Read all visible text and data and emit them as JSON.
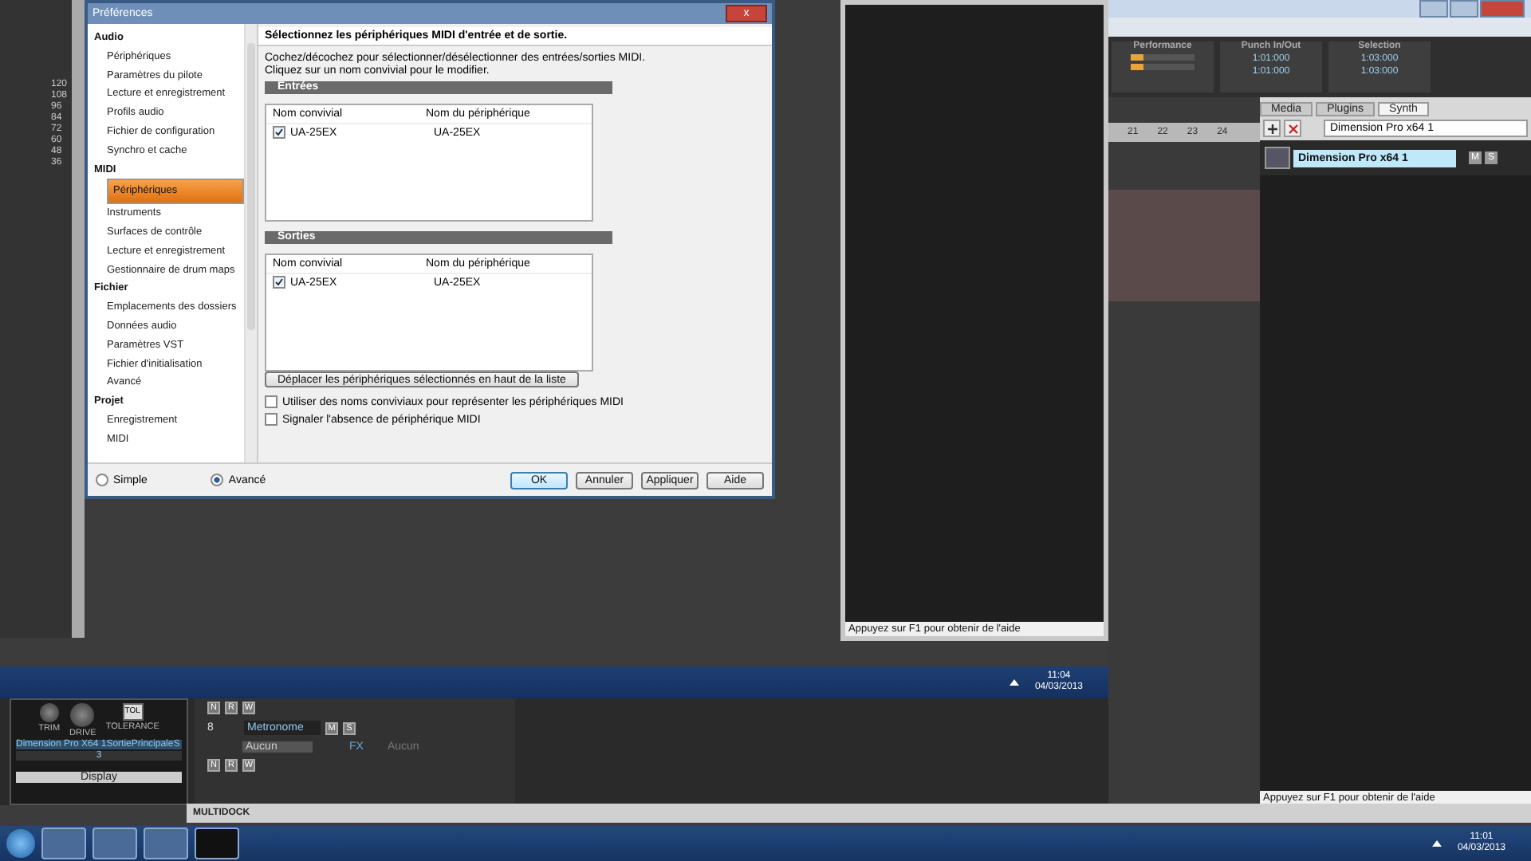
{
  "preferences": {
    "title": "Préférences",
    "close": "x",
    "tree": [
      {
        "label": "Audio",
        "children": [
          {
            "label": "Périphériques",
            "selected": false
          },
          {
            "label": "Paramètres du pilote",
            "selected": false
          },
          {
            "label": "Lecture et enregistrement",
            "selected": false
          },
          {
            "label": "Profils audio",
            "selected": false
          },
          {
            "label": "Fichier de configuration",
            "selected": false
          },
          {
            "label": "Synchro et cache",
            "selected": false
          }
        ]
      },
      {
        "label": "MIDI",
        "children": [
          {
            "label": "Périphériques",
            "selected": true
          },
          {
            "label": "Instruments",
            "selected": false
          },
          {
            "label": "Surfaces de contrôle",
            "selected": false
          },
          {
            "label": "Lecture et enregistrement",
            "selected": false
          },
          {
            "label": "Gestionnaire de drum maps",
            "selected": false
          }
        ]
      },
      {
        "label": "Fichier",
        "children": [
          {
            "label": "Emplacements des dossiers",
            "selected": false
          },
          {
            "label": "Données audio",
            "selected": false
          },
          {
            "label": "Paramètres VST",
            "selected": false
          },
          {
            "label": "Fichier d'initialisation",
            "selected": false
          },
          {
            "label": "Avancé",
            "selected": false
          }
        ]
      },
      {
        "label": "Projet",
        "children": [
          {
            "label": "Enregistrement",
            "selected": false
          },
          {
            "label": "MIDI",
            "selected": false
          }
        ]
      }
    ],
    "modes": [
      {
        "label": "Simple",
        "selected": false
      },
      {
        "label": "Avancé",
        "selected": true
      }
    ],
    "heading": "Sélectionnez les périphériques MIDI d'entrée et de sortie.",
    "instructions": [
      "Cochez/décochez pour sélectionner/désélectionner des entrées/sorties MIDI.",
      "Cliquez sur un nom convivial pour le modifier."
    ],
    "sections": [
      {
        "title": "Entrées",
        "columns": [
          "Nom convivial",
          "Nom du périphérique"
        ],
        "rows": [
          {
            "name": "UA-25EX",
            "device": "UA-25EX",
            "checked": true
          }
        ]
      },
      {
        "title": "Sorties",
        "columns": [
          "Nom convivial",
          "Nom du périphérique"
        ],
        "rows": [
          {
            "name": "UA-25EX",
            "device": "UA-25EX",
            "checked": true
          }
        ]
      }
    ],
    "move_button": "Déplacer les périphériques sélectionnés en haut de la liste",
    "options": [
      {
        "label": "Utiliser des noms conviviaux pour représenter les périphériques MIDI",
        "checked": false
      },
      {
        "label": "Signaler l'absence de périphérique MIDI",
        "checked": false
      }
    ],
    "buttons": [
      {
        "label": "OK",
        "default": true
      },
      {
        "label": "Annuler",
        "default": false
      },
      {
        "label": "Appliquer",
        "default": false
      },
      {
        "label": "Aide",
        "default": false
      }
    ]
  },
  "left_strip": {
    "scale": [
      "120",
      "108",
      "96",
      "84",
      "72",
      "60",
      "48",
      "36"
    ]
  },
  "mid_window": {
    "status": "Appuyez sur F1 pour obtenir de l'aide"
  },
  "mini_taskbar": {
    "time": "11:04",
    "date": "04/03/2013"
  },
  "control_bar": {
    "performance": "Performance",
    "punch": {
      "title": "Punch In/Out",
      "values": [
        "1:01:000",
        "1:01:000"
      ]
    },
    "selection": {
      "title": "Selection",
      "values": [
        "1:03:000",
        "1:03:000"
      ]
    }
  },
  "ruler": [
    "21",
    "22",
    "23",
    "24"
  ],
  "browser": {
    "tabs": [
      {
        "label": "Media",
        "selected": false
      },
      {
        "label": "Plugins",
        "selected": false
      },
      {
        "label": "Synth",
        "selected": true
      }
    ],
    "synth_select": "Dimension Pro x64 1",
    "synth": {
      "name": "Dimension Pro x64 1",
      "buttons": [
        "M",
        "S"
      ]
    },
    "status": "Appuyez sur F1 pour obtenir de l'aide"
  },
  "strip": {
    "knobs": [
      "TRIM",
      "DRIVE"
    ],
    "tol_button": "TOL",
    "tol_label": "TOLERANCE",
    "output": "Dimension Pro X64 1SortiePrincipaleS",
    "channel": "3",
    "display": "Display"
  },
  "track": {
    "rw_top": [
      "N",
      "R",
      "W"
    ],
    "number": "8",
    "name": "Metronome",
    "buttons": [
      "M",
      "S"
    ],
    "input": "Aucun",
    "fx": "FX",
    "fx_value": "Aucun",
    "rw_bottom": [
      "N",
      "R",
      "W"
    ]
  },
  "multidock": "MULTIDOCK",
  "taskbar": {
    "time": "11:01",
    "date": "04/03/2013"
  }
}
